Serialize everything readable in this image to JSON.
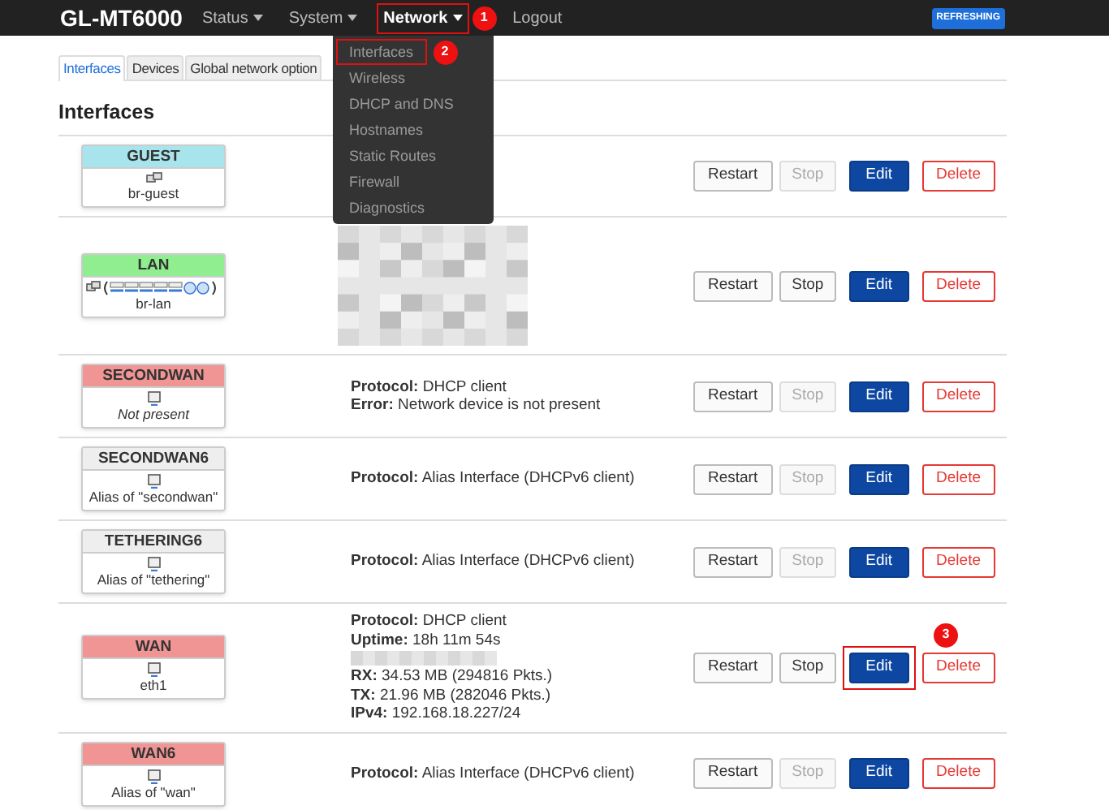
{
  "header": {
    "brand": "GL-MT6000",
    "nav": [
      {
        "label": "Status",
        "dropdown": true,
        "selected": false,
        "highlighted": false
      },
      {
        "label": "System",
        "dropdown": true,
        "selected": false,
        "highlighted": false
      },
      {
        "label": "Network",
        "dropdown": true,
        "selected": true,
        "highlighted": true,
        "callout": "1"
      },
      {
        "label": "Logout",
        "dropdown": false,
        "selected": false,
        "highlighted": false
      }
    ],
    "status_badge": "REFRESHING"
  },
  "network_menu": [
    {
      "label": "Interfaces",
      "highlighted": true,
      "callout": "2"
    },
    {
      "label": "Wireless",
      "highlighted": false
    },
    {
      "label": "DHCP and DNS",
      "highlighted": false
    },
    {
      "label": "Hostnames",
      "highlighted": false
    },
    {
      "label": "Static Routes",
      "highlighted": false
    },
    {
      "label": "Firewall",
      "highlighted": false
    },
    {
      "label": "Diagnostics",
      "highlighted": false
    }
  ],
  "tabs": [
    {
      "label": "Interfaces",
      "selected": true
    },
    {
      "label": "Devices",
      "selected": false
    },
    {
      "label": "Global network option",
      "selected": false
    }
  ],
  "heading": "Interfaces",
  "interfaces": [
    {
      "name": "GUEST",
      "color": "#a8e4ec",
      "device": "br-guest",
      "device_present": true,
      "stop_enabled": false,
      "edit_highlighted": false,
      "buttons": {
        "restart": "Restart",
        "stop": "Stop",
        "edit": "Edit",
        "delete": "Delete"
      }
    },
    {
      "name": "LAN",
      "color": "#90ee90",
      "device": "br-lan",
      "device_present": true,
      "details": [
        {
          "kind": "redacted-block"
        }
      ],
      "stop_enabled": true,
      "edit_highlighted": false,
      "buttons": {
        "restart": "Restart",
        "stop": "Stop",
        "edit": "Edit",
        "delete": "Delete"
      }
    },
    {
      "name": "SECONDWAN",
      "color": "#f09494",
      "device": "Not present",
      "device_present": false,
      "details": [
        {
          "kind": "text",
          "text": "**Protocol:** DHCP client"
        },
        {
          "kind": "text",
          "text": "**Error:** Network device is not present"
        }
      ],
      "stop_enabled": false,
      "edit_highlighted": false,
      "buttons": {
        "restart": "Restart",
        "stop": "Stop",
        "edit": "Edit",
        "delete": "Delete"
      }
    },
    {
      "name": "SECONDWAN6",
      "color": "#eeeeee",
      "device": "Alias of \"secondwan\"",
      "device_present": true,
      "details": [
        {
          "kind": "text",
          "text": "**Protocol:** Alias Interface (DHCPv6 client)"
        }
      ],
      "stop_enabled": false,
      "edit_highlighted": false,
      "buttons": {
        "restart": "Restart",
        "stop": "Stop",
        "edit": "Edit",
        "delete": "Delete"
      }
    },
    {
      "name": "TETHERING6",
      "color": "#eeeeee",
      "device": "Alias of \"tethering\"",
      "device_present": true,
      "details": [
        {
          "kind": "text",
          "text": "**Protocol:** Alias Interface (DHCPv6 client)"
        }
      ],
      "stop_enabled": false,
      "edit_highlighted": false,
      "buttons": {
        "restart": "Restart",
        "stop": "Stop",
        "edit": "Edit",
        "delete": "Delete"
      }
    },
    {
      "name": "WAN",
      "color": "#f09494",
      "device": "eth1",
      "device_present": true,
      "details": [
        {
          "kind": "text",
          "text": "**Protocol:** DHCP client"
        },
        {
          "kind": "text",
          "text": "**Uptime:** 18h 11m 54s"
        },
        {
          "kind": "redacted-strip"
        },
        {
          "kind": "text",
          "text": "**RX:** 34.53 MB (294816 Pkts.)"
        },
        {
          "kind": "text",
          "text": "**TX:** 21.96 MB (282046 Pkts.)"
        },
        {
          "kind": "text",
          "text": "**IPv4:** 192.168.18.227/24"
        }
      ],
      "stop_enabled": true,
      "edit_highlighted": true,
      "callout": "3",
      "buttons": {
        "restart": "Restart",
        "stop": "Stop",
        "edit": "Edit",
        "delete": "Delete"
      }
    },
    {
      "name": "WAN6",
      "color": "#f09494",
      "device": "Alias of \"wan\"",
      "device_present": true,
      "details": [
        {
          "kind": "text",
          "text": "**Protocol:** Alias Interface (DHCPv6 client)"
        }
      ],
      "stop_enabled": false,
      "edit_highlighted": false,
      "buttons": {
        "restart": "Restart",
        "stop": "Stop",
        "edit": "Edit",
        "delete": "Delete"
      }
    }
  ]
}
